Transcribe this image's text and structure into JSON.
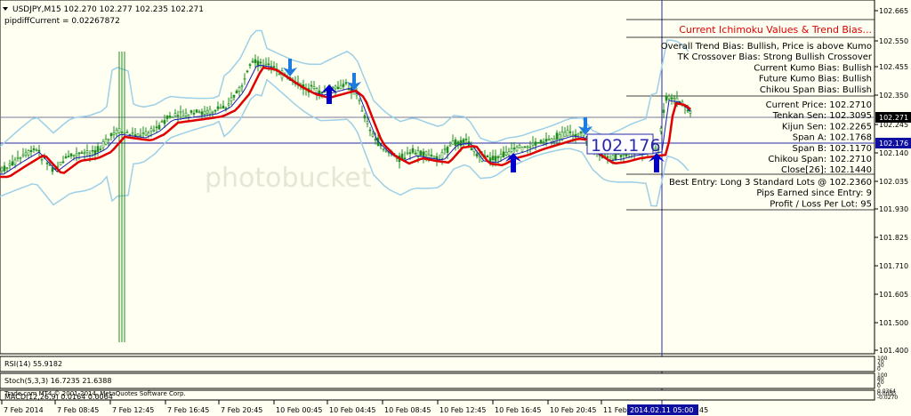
{
  "header": {
    "symbol_line": "USDJPY,M15  102.270 102.277 102.235 102.271",
    "indicator_line": "pipdiffCurrent = 0.02267872"
  },
  "overlay": {
    "title": "Current Ichimoku Values & Trend Bias...",
    "bias_lines": [
      "Overall Trend Bias: Bullish, Price is above Kumo",
      "TK Crossover Bias: Strong Bullish Crossover",
      "Current Kumo Bias: Bullish",
      "Future Kumo Bias: Bullish",
      "Chikou Span Bias: Bullish"
    ],
    "value_lines": [
      "Current Price: 102.2710",
      "Tenkan Sen: 102.3095",
      "Kijun Sen: 102.2265",
      "Span A: 102.1768",
      "Span B: 102.1170",
      "Chikou Span: 102.2710",
      "Close[26]: 102.1440"
    ],
    "entry_lines": [
      "Best Entry: Long 3 Standard Lots @ 102.2360",
      "Pips Earned since Entry: 9",
      "Profit / Loss Per Lot: 95"
    ],
    "entry_box_price": "102.176"
  },
  "price_axis": {
    "ticks": [
      "102.665",
      "102.550",
      "102.455",
      "102.350",
      "102.245",
      "102.140",
      "102.035",
      "101.930",
      "101.825",
      "101.710",
      "101.605",
      "101.500",
      "101.400"
    ],
    "current_price_tag": "102.271",
    "hline_price_tag": "102.176"
  },
  "time_axis": {
    "labels": [
      "7 Feb 2014",
      "7 Feb 08:45",
      "7 Feb 12:45",
      "7 Feb 16:45",
      "7 Feb 20:45",
      "10 Feb 00:45",
      "10 Feb 04:45",
      "10 Feb 08:45",
      "10 Feb 12:45",
      "10 Feb 16:45",
      "10 Feb 20:45",
      "11 Feb"
    ],
    "cursor_time": "2014.02.11 05:00",
    "tail_text": "45"
  },
  "subwindows": {
    "rsi_label": "RSI(14) 55.9182",
    "rsi_axis": [
      "100",
      "70",
      "30",
      "0"
    ],
    "stoch_label": "Stoch(5,3,3) 16.7235 21.6388",
    "stoch_axis": [
      "100",
      "80",
      "20",
      "0"
    ],
    "macd_label": "MACD(12,26,9) 0.0164 0.0064",
    "macd_axis": [
      "0.0364",
      "0.0000",
      "-0.0270"
    ],
    "copyright": "Trade.com MT4 © 2001-2014, MetaQuotes Software Corp."
  },
  "colors": {
    "background": "#fffff2",
    "candles": "#1e8c1e",
    "bollinger": "#9ccfe8",
    "ma_red": "#e00000",
    "ma_blue": "#1e1eb4",
    "arrows": "#0000cc",
    "title_red": "#e00000",
    "price_tag_bg": "#1010a0"
  },
  "icons": {
    "collapse": "chevron-down-icon",
    "buy_arrow": "up-arrow-icon",
    "sell_arrow": "down-arrow-icon"
  }
}
